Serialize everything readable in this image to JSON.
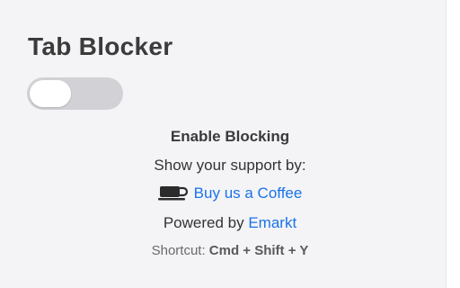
{
  "app": {
    "title": "Tab Blocker"
  },
  "toggle": {
    "enabled": false
  },
  "labels": {
    "enable": "Enable Blocking",
    "support": "Show your support by:",
    "coffee_link": "Buy us a Coffee",
    "powered_prefix": "Powered by",
    "powered_link": "Emarkt",
    "shortcut_prefix": "Shortcut:",
    "shortcut_keys": "Cmd + Shift + Y"
  },
  "icons": {
    "coffee": "coffee-cup-icon"
  },
  "colors": {
    "background": "#f4f4f7",
    "link": "#1a73e8",
    "toggle_off": "#d2d2d6"
  }
}
